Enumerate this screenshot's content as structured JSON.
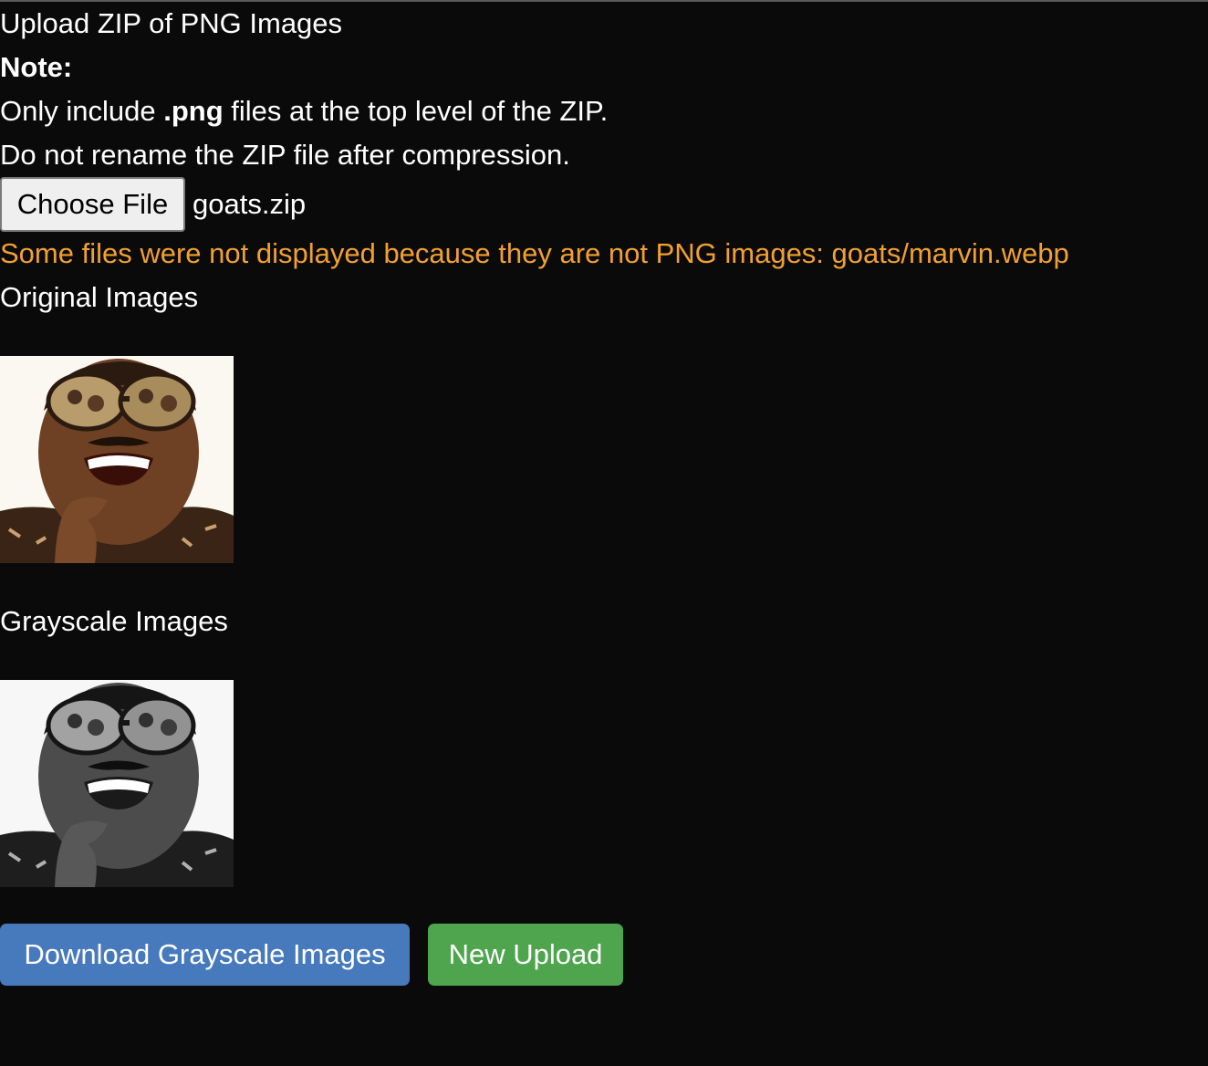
{
  "page": {
    "heading": "Upload ZIP of PNG Images",
    "note_label": "Note:",
    "note_line1": {
      "before": "Only include ",
      "ext": ".png",
      "after": " files at the top level of the ZIP."
    },
    "note_line2": "Do not rename the ZIP file after compression."
  },
  "file_input": {
    "button_label": "Choose File",
    "selected_file": "goats.zip"
  },
  "warning": {
    "text": "Some files were not displayed because they are not PNG images: goats/marvin.webp",
    "color": "#f0a030"
  },
  "sections": {
    "original_title": "Original Images",
    "grayscale_title": "Grayscale Images"
  },
  "actions": {
    "download_label": "Download Grayscale Images",
    "download_color": "#4779bd",
    "new_upload_label": "New Upload",
    "new_upload_color": "#4ea54e"
  }
}
